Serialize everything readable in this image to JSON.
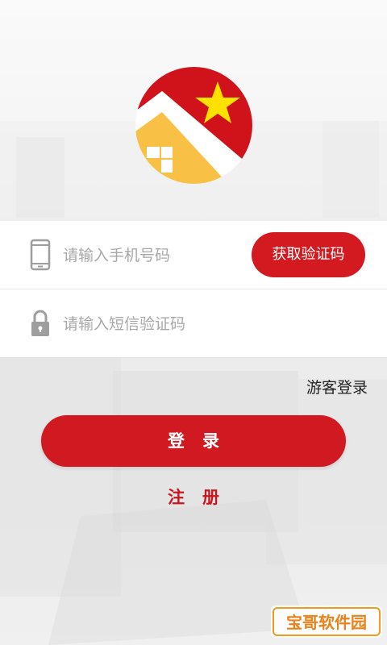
{
  "colors": {
    "brand_red": "#d31a21",
    "logo_yellow": "#f8c146",
    "star_yellow": "#ffe100",
    "placeholder_gray": "#a8a8a8"
  },
  "logo": {
    "icon": "house-star-logo"
  },
  "phone_field": {
    "icon": "phone-icon",
    "placeholder": "请输入手机号码",
    "value": ""
  },
  "get_code_button": {
    "label": "获取验证码"
  },
  "sms_field": {
    "icon": "lock-icon",
    "placeholder": "请输入短信验证码",
    "value": ""
  },
  "guest_login": {
    "label": "游客登录"
  },
  "login_button": {
    "label": "登录"
  },
  "register_link": {
    "label": "注册"
  },
  "watermark": {
    "text": "宝哥软件园"
  }
}
